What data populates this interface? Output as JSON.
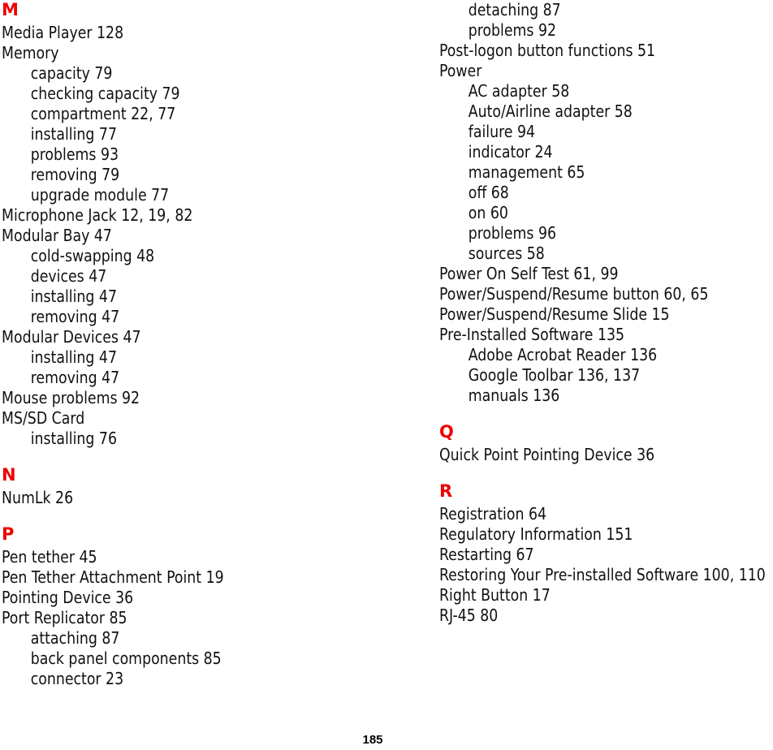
{
  "document": {
    "type": "index-page",
    "page_number": "185",
    "heading_color": "#ee0000",
    "text_color": "#111111"
  },
  "left_column": {
    "sections": [
      {
        "letter": "M",
        "entries": [
          {
            "text": "Media Player 128",
            "level": "main"
          },
          {
            "text": "Memory",
            "level": "main"
          },
          {
            "text": "capacity 79",
            "level": "sub"
          },
          {
            "text": "checking capacity 79",
            "level": "sub"
          },
          {
            "text": "compartment 22, 77",
            "level": "sub"
          },
          {
            "text": "installing 77",
            "level": "sub"
          },
          {
            "text": "problems 93",
            "level": "sub"
          },
          {
            "text": "removing 79",
            "level": "sub"
          },
          {
            "text": "upgrade module 77",
            "level": "sub"
          },
          {
            "text": "Microphone Jack 12, 19, 82",
            "level": "main"
          },
          {
            "text": "Modular Bay 47",
            "level": "main"
          },
          {
            "text": "cold-swapping 48",
            "level": "sub"
          },
          {
            "text": "devices 47",
            "level": "sub"
          },
          {
            "text": "installing 47",
            "level": "sub"
          },
          {
            "text": "removing 47",
            "level": "sub"
          },
          {
            "text": "Modular Devices 47",
            "level": "main"
          },
          {
            "text": "installing 47",
            "level": "sub"
          },
          {
            "text": "removing 47",
            "level": "sub"
          },
          {
            "text": "Mouse problems 92",
            "level": "main"
          },
          {
            "text": "MS/SD Card",
            "level": "main"
          },
          {
            "text": "installing 76",
            "level": "sub"
          }
        ]
      },
      {
        "letter": "N",
        "entries": [
          {
            "text": "NumLk 26",
            "level": "main"
          }
        ]
      },
      {
        "letter": "P",
        "entries": [
          {
            "text": "Pen tether 45",
            "level": "main"
          },
          {
            "text": "Pen Tether Attachment Point 19",
            "level": "main"
          },
          {
            "text": "Pointing Device 36",
            "level": "main"
          },
          {
            "text": "Port Replicator 85",
            "level": "main"
          },
          {
            "text": "attaching 87",
            "level": "sub"
          },
          {
            "text": "back panel components 85",
            "level": "sub"
          },
          {
            "text": "connector 23",
            "level": "sub"
          }
        ]
      }
    ]
  },
  "right_column": {
    "continuation_entries": [
      {
        "text": "detaching 87",
        "level": "sub"
      },
      {
        "text": "problems 92",
        "level": "sub"
      },
      {
        "text": "Post-logon button functions 51",
        "level": "main"
      },
      {
        "text": "Power",
        "level": "main"
      },
      {
        "text": "AC adapter 58",
        "level": "sub"
      },
      {
        "text": "Auto/Airline adapter 58",
        "level": "sub"
      },
      {
        "text": "failure 94",
        "level": "sub"
      },
      {
        "text": "indicator 24",
        "level": "sub"
      },
      {
        "text": "management 65",
        "level": "sub"
      },
      {
        "text": "off 68",
        "level": "sub"
      },
      {
        "text": "on 60",
        "level": "sub"
      },
      {
        "text": "problems 96",
        "level": "sub"
      },
      {
        "text": "sources 58",
        "level": "sub"
      },
      {
        "text": "Power On Self Test 61, 99",
        "level": "main"
      },
      {
        "text": "Power/Suspend/Resume button 60, 65",
        "level": "main"
      },
      {
        "text": "Power/Suspend/Resume Slide 15",
        "level": "main"
      },
      {
        "text": "Pre-Installed Software 135",
        "level": "main"
      },
      {
        "text": "Adobe Acrobat Reader 136",
        "level": "sub"
      },
      {
        "text": "Google Toolbar 136, 137",
        "level": "sub"
      },
      {
        "text": "manuals 136",
        "level": "sub"
      }
    ],
    "sections": [
      {
        "letter": "Q",
        "entries": [
          {
            "text": "Quick Point Pointing Device 36",
            "level": "main"
          }
        ]
      },
      {
        "letter": "R",
        "entries": [
          {
            "text": "Registration 64",
            "level": "main"
          },
          {
            "text": "Regulatory Information 151",
            "level": "main"
          },
          {
            "text": "Restarting 67",
            "level": "main"
          },
          {
            "text": "Restoring Your Pre-installed Software 100, 110",
            "level": "main"
          },
          {
            "text": "Right Button 17",
            "level": "main"
          },
          {
            "text": "RJ-45 80",
            "level": "main"
          }
        ]
      }
    ]
  }
}
